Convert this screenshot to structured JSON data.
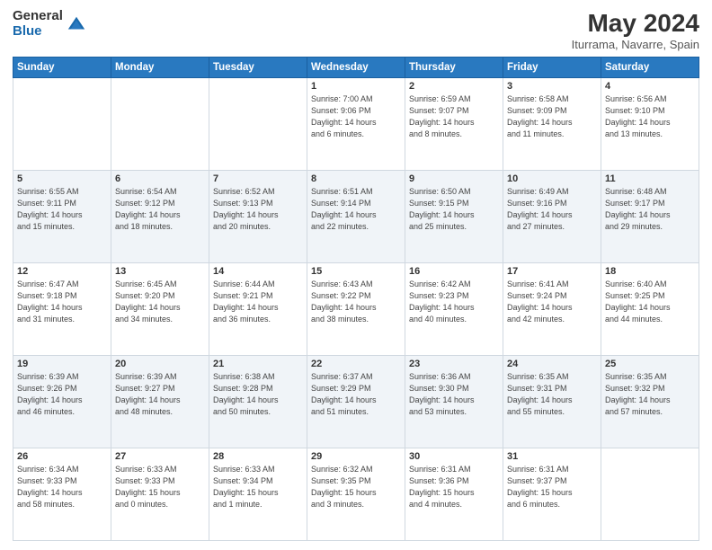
{
  "logo": {
    "general": "General",
    "blue": "Blue"
  },
  "title": "May 2024",
  "subtitle": "Iturrama, Navarre, Spain",
  "headers": [
    "Sunday",
    "Monday",
    "Tuesday",
    "Wednesday",
    "Thursday",
    "Friday",
    "Saturday"
  ],
  "weeks": [
    [
      {
        "num": "",
        "detail": ""
      },
      {
        "num": "",
        "detail": ""
      },
      {
        "num": "",
        "detail": ""
      },
      {
        "num": "1",
        "detail": "Sunrise: 7:00 AM\nSunset: 9:06 PM\nDaylight: 14 hours\nand 6 minutes."
      },
      {
        "num": "2",
        "detail": "Sunrise: 6:59 AM\nSunset: 9:07 PM\nDaylight: 14 hours\nand 8 minutes."
      },
      {
        "num": "3",
        "detail": "Sunrise: 6:58 AM\nSunset: 9:09 PM\nDaylight: 14 hours\nand 11 minutes."
      },
      {
        "num": "4",
        "detail": "Sunrise: 6:56 AM\nSunset: 9:10 PM\nDaylight: 14 hours\nand 13 minutes."
      }
    ],
    [
      {
        "num": "5",
        "detail": "Sunrise: 6:55 AM\nSunset: 9:11 PM\nDaylight: 14 hours\nand 15 minutes."
      },
      {
        "num": "6",
        "detail": "Sunrise: 6:54 AM\nSunset: 9:12 PM\nDaylight: 14 hours\nand 18 minutes."
      },
      {
        "num": "7",
        "detail": "Sunrise: 6:52 AM\nSunset: 9:13 PM\nDaylight: 14 hours\nand 20 minutes."
      },
      {
        "num": "8",
        "detail": "Sunrise: 6:51 AM\nSunset: 9:14 PM\nDaylight: 14 hours\nand 22 minutes."
      },
      {
        "num": "9",
        "detail": "Sunrise: 6:50 AM\nSunset: 9:15 PM\nDaylight: 14 hours\nand 25 minutes."
      },
      {
        "num": "10",
        "detail": "Sunrise: 6:49 AM\nSunset: 9:16 PM\nDaylight: 14 hours\nand 27 minutes."
      },
      {
        "num": "11",
        "detail": "Sunrise: 6:48 AM\nSunset: 9:17 PM\nDaylight: 14 hours\nand 29 minutes."
      }
    ],
    [
      {
        "num": "12",
        "detail": "Sunrise: 6:47 AM\nSunset: 9:18 PM\nDaylight: 14 hours\nand 31 minutes."
      },
      {
        "num": "13",
        "detail": "Sunrise: 6:45 AM\nSunset: 9:20 PM\nDaylight: 14 hours\nand 34 minutes."
      },
      {
        "num": "14",
        "detail": "Sunrise: 6:44 AM\nSunset: 9:21 PM\nDaylight: 14 hours\nand 36 minutes."
      },
      {
        "num": "15",
        "detail": "Sunrise: 6:43 AM\nSunset: 9:22 PM\nDaylight: 14 hours\nand 38 minutes."
      },
      {
        "num": "16",
        "detail": "Sunrise: 6:42 AM\nSunset: 9:23 PM\nDaylight: 14 hours\nand 40 minutes."
      },
      {
        "num": "17",
        "detail": "Sunrise: 6:41 AM\nSunset: 9:24 PM\nDaylight: 14 hours\nand 42 minutes."
      },
      {
        "num": "18",
        "detail": "Sunrise: 6:40 AM\nSunset: 9:25 PM\nDaylight: 14 hours\nand 44 minutes."
      }
    ],
    [
      {
        "num": "19",
        "detail": "Sunrise: 6:39 AM\nSunset: 9:26 PM\nDaylight: 14 hours\nand 46 minutes."
      },
      {
        "num": "20",
        "detail": "Sunrise: 6:39 AM\nSunset: 9:27 PM\nDaylight: 14 hours\nand 48 minutes."
      },
      {
        "num": "21",
        "detail": "Sunrise: 6:38 AM\nSunset: 9:28 PM\nDaylight: 14 hours\nand 50 minutes."
      },
      {
        "num": "22",
        "detail": "Sunrise: 6:37 AM\nSunset: 9:29 PM\nDaylight: 14 hours\nand 51 minutes."
      },
      {
        "num": "23",
        "detail": "Sunrise: 6:36 AM\nSunset: 9:30 PM\nDaylight: 14 hours\nand 53 minutes."
      },
      {
        "num": "24",
        "detail": "Sunrise: 6:35 AM\nSunset: 9:31 PM\nDaylight: 14 hours\nand 55 minutes."
      },
      {
        "num": "25",
        "detail": "Sunrise: 6:35 AM\nSunset: 9:32 PM\nDaylight: 14 hours\nand 57 minutes."
      }
    ],
    [
      {
        "num": "26",
        "detail": "Sunrise: 6:34 AM\nSunset: 9:33 PM\nDaylight: 14 hours\nand 58 minutes."
      },
      {
        "num": "27",
        "detail": "Sunrise: 6:33 AM\nSunset: 9:33 PM\nDaylight: 15 hours\nand 0 minutes."
      },
      {
        "num": "28",
        "detail": "Sunrise: 6:33 AM\nSunset: 9:34 PM\nDaylight: 15 hours\nand 1 minute."
      },
      {
        "num": "29",
        "detail": "Sunrise: 6:32 AM\nSunset: 9:35 PM\nDaylight: 15 hours\nand 3 minutes."
      },
      {
        "num": "30",
        "detail": "Sunrise: 6:31 AM\nSunset: 9:36 PM\nDaylight: 15 hours\nand 4 minutes."
      },
      {
        "num": "31",
        "detail": "Sunrise: 6:31 AM\nSunset: 9:37 PM\nDaylight: 15 hours\nand 6 minutes."
      },
      {
        "num": "",
        "detail": ""
      }
    ]
  ]
}
